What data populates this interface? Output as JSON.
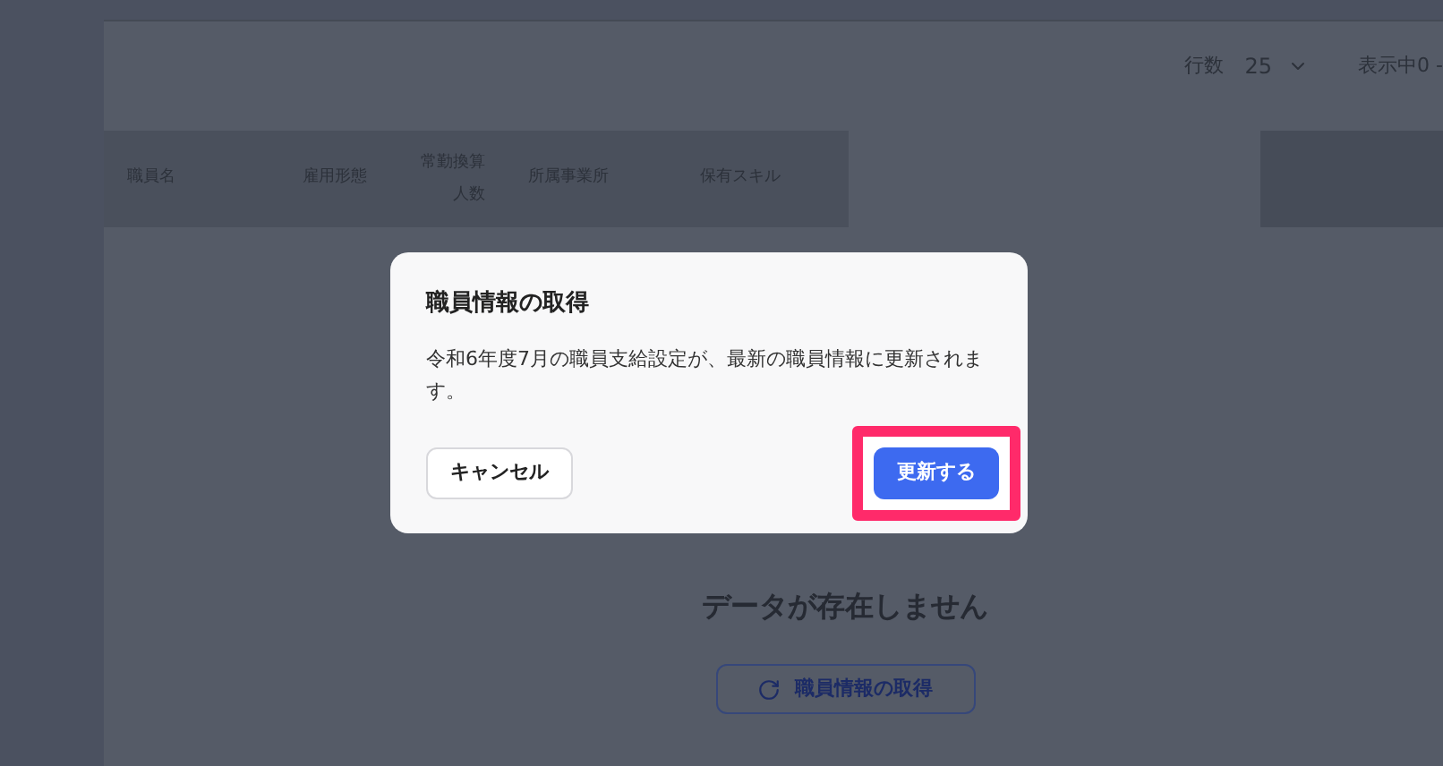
{
  "pagination": {
    "rows_label": "行数",
    "rows_value": "25",
    "range_text": "表示中0 -"
  },
  "table": {
    "columns": [
      "職員名",
      "雇用形態",
      "常勤換算人数",
      "所属事業所",
      "保有スキル"
    ]
  },
  "empty_state": {
    "message": "データが存在しません",
    "button": "職員情報の取得"
  },
  "dialog": {
    "title": "職員情報の取得",
    "body": "令和6年度7月の職員支給設定が、最新の職員情報に更新されます。",
    "cancel_button": "キャンセル",
    "confirm_button": "更新する",
    "confirm_highlighted": true
  }
}
